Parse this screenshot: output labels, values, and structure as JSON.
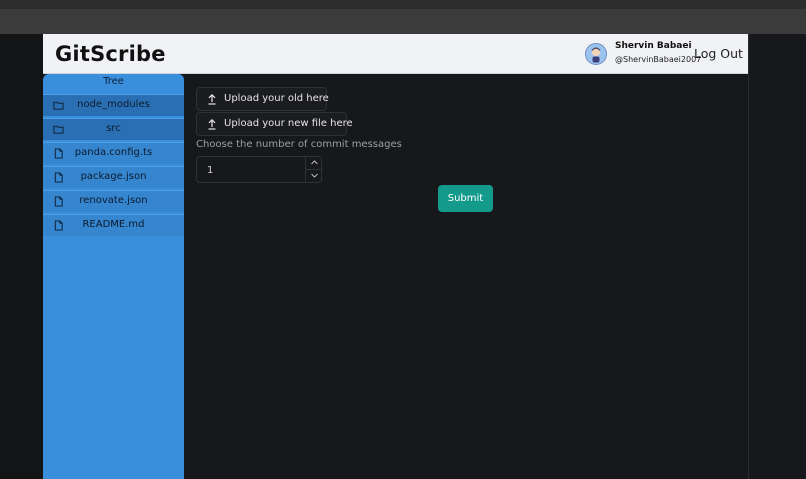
{
  "app": {
    "brand": "GitScribe",
    "user": {
      "name": "Shervin Babaei",
      "handle": "@ShervinBabaei2007"
    },
    "logout_label": "Log Out"
  },
  "sidebar": {
    "title": "Tree",
    "items": [
      {
        "label": "node_modules",
        "type": "folder",
        "icon": "folder-icon"
      },
      {
        "label": "src",
        "type": "folder",
        "icon": "folder-icon"
      },
      {
        "label": "panda.config.ts",
        "type": "file",
        "icon": "file-icon"
      },
      {
        "label": "package.json",
        "type": "file",
        "icon": "file-icon"
      },
      {
        "label": "renovate.json",
        "type": "file",
        "icon": "file-icon"
      },
      {
        "label": "README.md",
        "type": "file",
        "icon": "file-icon"
      }
    ]
  },
  "main": {
    "upload_old_label": "Upload your old here",
    "upload_new_label": "Upload your new file here",
    "commit_count_label": "Choose the number of commit messages",
    "commit_count_value": "1",
    "submit_label": "Submit"
  },
  "colors": {
    "background": "#17181c",
    "header": "#f0f2f5",
    "sidebar": "#3a8fdc",
    "folder_row": "#2a6fb3",
    "submit": "#139a8a"
  }
}
